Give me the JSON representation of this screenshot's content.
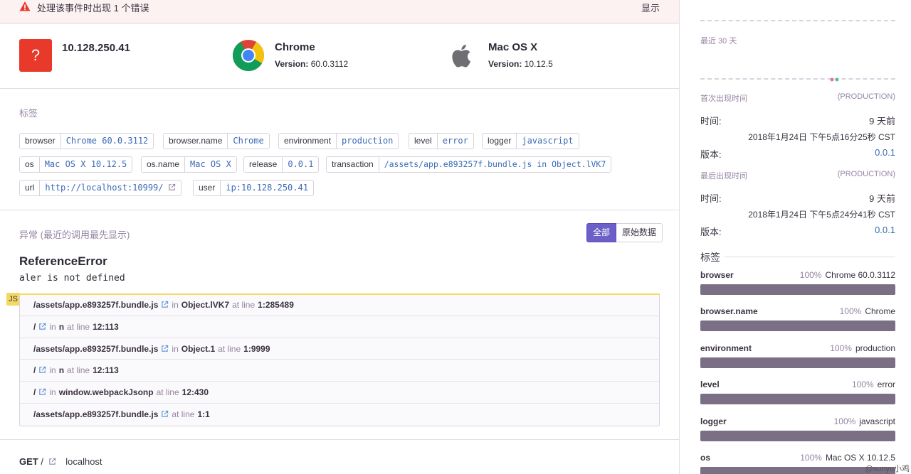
{
  "banner": {
    "message": "处理该事件时出现 1 个错误",
    "show_label": "显示"
  },
  "contexts": {
    "user": {
      "title": "10.128.250.41",
      "icon": "question-mark-icon"
    },
    "browser": {
      "title": "Chrome",
      "version_label": "Version:",
      "version": "60.0.3112",
      "icon": "chrome-icon"
    },
    "os": {
      "title": "Mac OS X",
      "version_label": "Version:",
      "version": "10.12.5",
      "icon": "apple-icon"
    }
  },
  "tags": {
    "title": "标签",
    "items": [
      {
        "key": "browser",
        "value": "Chrome 60.0.3112"
      },
      {
        "key": "browser.name",
        "value": "Chrome"
      },
      {
        "key": "environment",
        "value": "production"
      },
      {
        "key": "level",
        "value": "error"
      },
      {
        "key": "logger",
        "value": "javascript"
      },
      {
        "key": "os",
        "value": "Mac OS X 10.12.5"
      },
      {
        "key": "os.name",
        "value": "Mac OS X"
      },
      {
        "key": "release",
        "value": "0.0.1"
      },
      {
        "key": "transaction",
        "value": "/assets/app.e893257f.bundle.js in Object.lVK7"
      },
      {
        "key": "url",
        "value": "http://localhost:10999/"
      },
      {
        "key": "user",
        "value": "ip:10.128.250.41"
      }
    ]
  },
  "exception": {
    "title": "异常 (最近的调用最先显示)",
    "toggle_all": "全部",
    "toggle_raw": "原始数据",
    "type": "ReferenceError",
    "value": "aler is not defined",
    "platform_badge": "JS",
    "frames": [
      {
        "file": "/assets/app.e893257f.bundle.js",
        "in": "in",
        "function": "Object.lVK7",
        "at": "at line",
        "line": "1:285489"
      },
      {
        "file": "/",
        "in": "in",
        "function": "n",
        "at": "at line",
        "line": "12:113"
      },
      {
        "file": "/assets/app.e893257f.bundle.js",
        "in": "in",
        "function": "Object.1",
        "at": "at line",
        "line": "1:9999"
      },
      {
        "file": "/",
        "in": "in",
        "function": "n",
        "at": "at line",
        "line": "12:113"
      },
      {
        "file": "/",
        "in": "in",
        "function": "window.webpackJsonp",
        "at": "at line",
        "line": "12:430"
      },
      {
        "file": "/assets/app.e893257f.bundle.js",
        "in": "",
        "function": "",
        "at": "at line",
        "line": "1:1"
      }
    ]
  },
  "request": {
    "method": "GET",
    "path": "/",
    "host": "localhost"
  },
  "sidebar": {
    "last30": "最近 30 天",
    "first_seen": {
      "label": "首次出现时间",
      "env": "(PRODUCTION)",
      "time_label": "时间:",
      "time": "9 天前",
      "date": "2018年1月24日 下午5点16分25秒 CST",
      "release_label": "版本:",
      "release": "0.0.1"
    },
    "last_seen": {
      "label": "最后出现时间",
      "env": "(PRODUCTION)",
      "time_label": "时间:",
      "time": "9 天前",
      "date": "2018年1月24日 下午5点24分41秒 CST",
      "release_label": "版本:",
      "release": "0.0.1"
    },
    "tags_title": "标签",
    "tag_stats": [
      {
        "name": "browser",
        "pct": "100%",
        "value": "Chrome 60.0.3112",
        "fill": 1.0
      },
      {
        "name": "browser.name",
        "pct": "100%",
        "value": "Chrome",
        "fill": 1.0
      },
      {
        "name": "environment",
        "pct": "100%",
        "value": "production",
        "fill": 1.0
      },
      {
        "name": "level",
        "pct": "100%",
        "value": "error",
        "fill": 1.0
      },
      {
        "name": "logger",
        "pct": "100%",
        "value": "javascript",
        "fill": 1.0
      },
      {
        "name": "os",
        "pct": "100%",
        "value": "Mac OS X 10.12.5",
        "fill": 1.0
      }
    ],
    "watermark": "@sunyu小鸡"
  },
  "colors": {
    "accent": "#6c5fc7",
    "link": "#3b6ab7",
    "error": "#e8392a",
    "bar": "#7a6f85"
  }
}
